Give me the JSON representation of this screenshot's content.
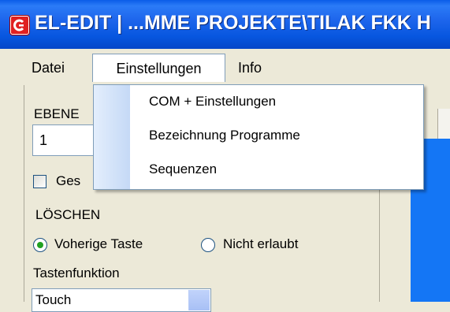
{
  "window": {
    "title": "EL-EDIT | ...MME PROJEKTE\\TILAK FKK H",
    "icon": "app-logo-icon"
  },
  "menubar": {
    "items": [
      {
        "label": "Datei"
      },
      {
        "label": "Einstellungen"
      },
      {
        "label": "Info"
      }
    ]
  },
  "dropdown": {
    "items": [
      {
        "label": "COM + Einstellungen"
      },
      {
        "label": "Bezeichnung Programme"
      },
      {
        "label": "Sequenzen"
      }
    ]
  },
  "panel": {
    "ebene_label": "EBENE",
    "ebene_value": "1",
    "checkbox_label": "Ges",
    "checkbox_checked": false,
    "loeschen_label": "LÖSCHEN",
    "radio_options": [
      {
        "label": "Voherige Taste",
        "selected": true
      },
      {
        "label": "Nicht erlaubt",
        "selected": false
      }
    ],
    "tastenfunktion_label": "Tastenfunktion",
    "tastenfunktion_value": "Touch"
  },
  "colors": {
    "titlebar": "#0a5ce8",
    "accent_blue": "#1476f5",
    "radio_dot": "#21a121"
  }
}
